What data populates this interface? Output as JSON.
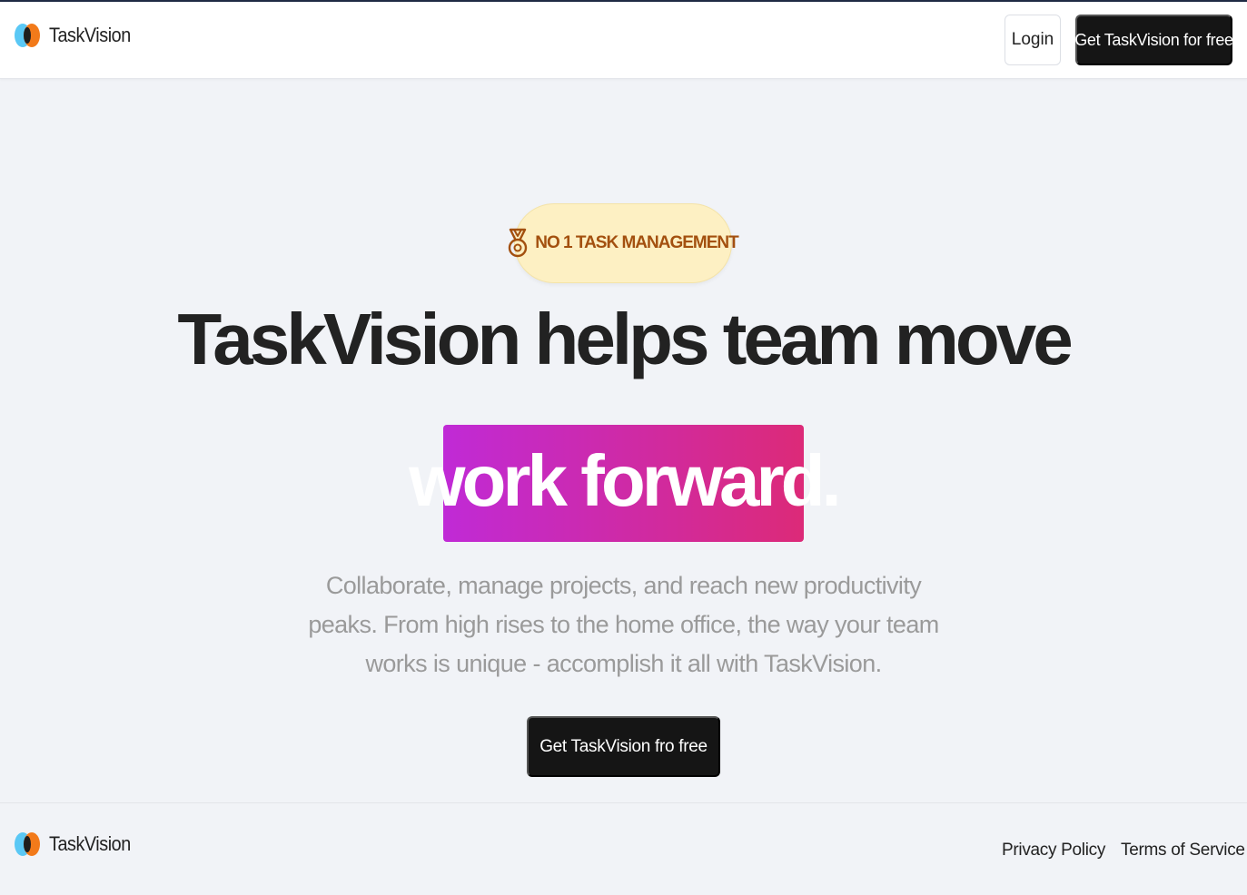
{
  "brand": {
    "name": "TaskVision",
    "logo_icon": "taskvision-logo-icon",
    "colors": {
      "left": "#5ac8f5",
      "right": "#f27a1a",
      "center": "#1e1e1e"
    }
  },
  "header": {
    "login_label": "Login",
    "get_free_label": "Get TaskVision for free"
  },
  "hero": {
    "badge": {
      "icon": "medal-icon",
      "text": "NO 1 TASK MANAGEMENT",
      "bg_color": "#fdf0c3",
      "text_color": "#a3500f"
    },
    "headline": "TaskVision helps team move",
    "highlight": "work forward.",
    "highlight_gradient": [
      "#c02ad6",
      "#dc2a78"
    ],
    "description": "Collaborate, manage projects, and reach new productivity peaks. From high rises to the home office, the way your team works is unique - accomplish it all with TaskVision.",
    "cta_label": "Get TaskVision fro free"
  },
  "footer": {
    "brand_name": "TaskVision",
    "links": [
      {
        "label": "Privacy Policy"
      },
      {
        "label": "Terms of Service"
      }
    ]
  }
}
